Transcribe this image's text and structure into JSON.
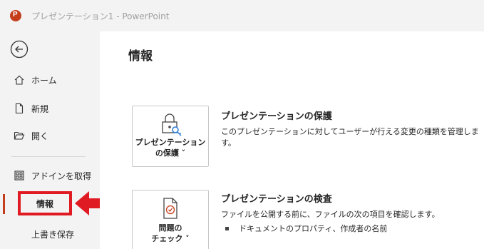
{
  "window": {
    "title": "プレゼンテーション1  -  PowerPoint",
    "app_icon_letter": "P"
  },
  "sidebar": {
    "items": [
      {
        "label": "ホーム",
        "icon": "home-icon"
      },
      {
        "label": "新規",
        "icon": "new-document-icon"
      },
      {
        "label": "開く",
        "icon": "folder-open-icon"
      },
      {
        "label": "アドインを取得",
        "icon": "grid-icon"
      },
      {
        "label": "情報",
        "icon": ""
      },
      {
        "label": "上書き保存",
        "icon": ""
      }
    ],
    "active": "情報"
  },
  "main": {
    "title": "情報",
    "sections": [
      {
        "button_line1": "プレゼンテーション",
        "button_line2": "の保護 ˅",
        "icon": "lock-key-icon",
        "heading": "プレゼンテーションの保護",
        "description": "このプレゼンテーションに対してユーザーが行える変更の種類を管理します。"
      },
      {
        "button_line1": "問題の",
        "button_line2": "チェック ˅",
        "icon": "document-check-icon",
        "heading": "プレゼンテーションの検査",
        "description": "ファイルを公開する前に、ファイルの次の項目を確認します。",
        "bullets": [
          "ドキュメントのプロパティ、作成者の名前"
        ]
      }
    ]
  },
  "colors": {
    "accent": "#c43e1c",
    "highlight": "#e01a22"
  }
}
